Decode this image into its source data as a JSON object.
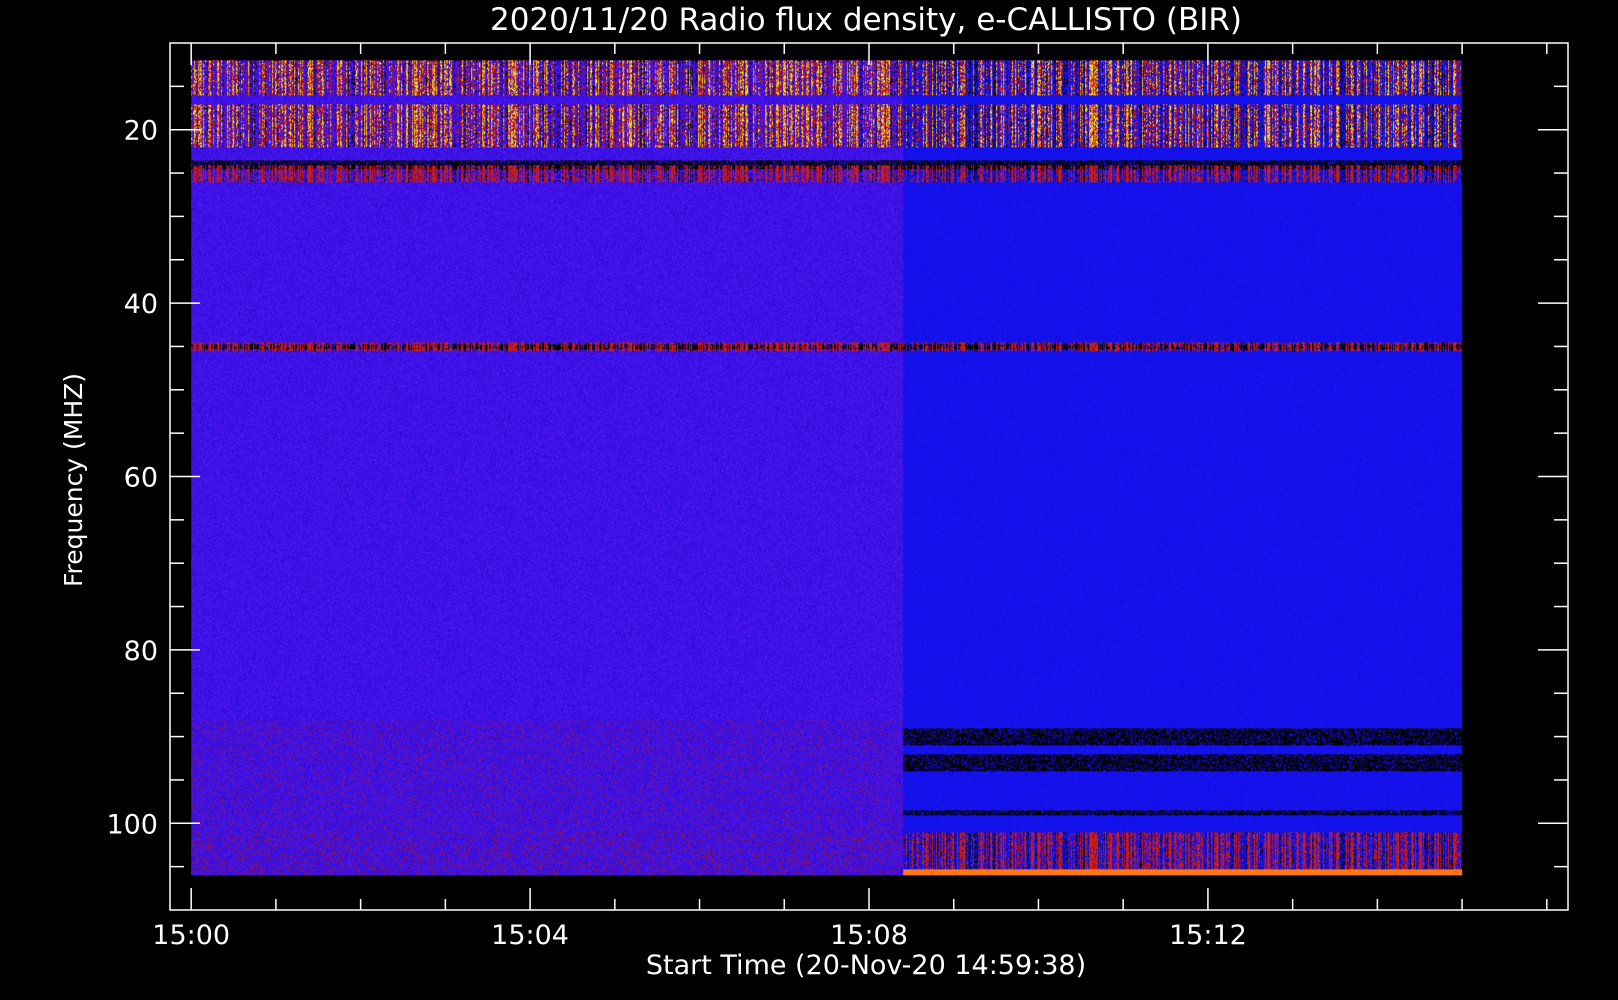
{
  "chart_data": {
    "type": "heatmap",
    "title": "2020/11/20  Radio flux density, e-CALLISTO (BIR)",
    "xlabel": "Start Time (20-Nov-20 14:59:38)",
    "ylabel": "Frequency (MHZ)",
    "x_tick_labels": [
      "15:00",
      "15:04",
      "15:08",
      "15:12"
    ],
    "x_ticks_min": [
      0,
      4,
      8,
      12
    ],
    "x_minor_step_min": 1,
    "xlim_min": [
      -0.25,
      16.25
    ],
    "data_x_range_min": [
      0,
      15
    ],
    "y_ticks": [
      20,
      40,
      60,
      80,
      100
    ],
    "y_minor_step": 5,
    "ylim": [
      10,
      110
    ],
    "y_reversed": true,
    "data_y_range": [
      12,
      106
    ],
    "receiver_switch_min": 8.4,
    "colors": {
      "background": "#000000",
      "low": "#1212e6",
      "mid": "#c01818",
      "high": "#ffe040",
      "void": "#000000"
    },
    "bright_bands_mhz": [
      {
        "f0": 12,
        "f1": 16,
        "level": "high"
      },
      {
        "f0": 17,
        "f1": 22,
        "level": "high"
      },
      {
        "f0": 24,
        "f1": 26,
        "level": "mid"
      },
      {
        "f0": 44.5,
        "f1": 45.5,
        "level": "mid"
      },
      {
        "f0": 101,
        "f1": 106,
        "level": "mid"
      }
    ],
    "dark_bands_mhz": [
      {
        "f0": 23.5,
        "f1": 24.5
      },
      {
        "f0": 44.7,
        "f1": 45.3
      },
      {
        "f0": 89,
        "f1": 91
      },
      {
        "f0": 92,
        "f1": 94
      },
      {
        "f0": 98.5,
        "f1": 99
      }
    ]
  }
}
